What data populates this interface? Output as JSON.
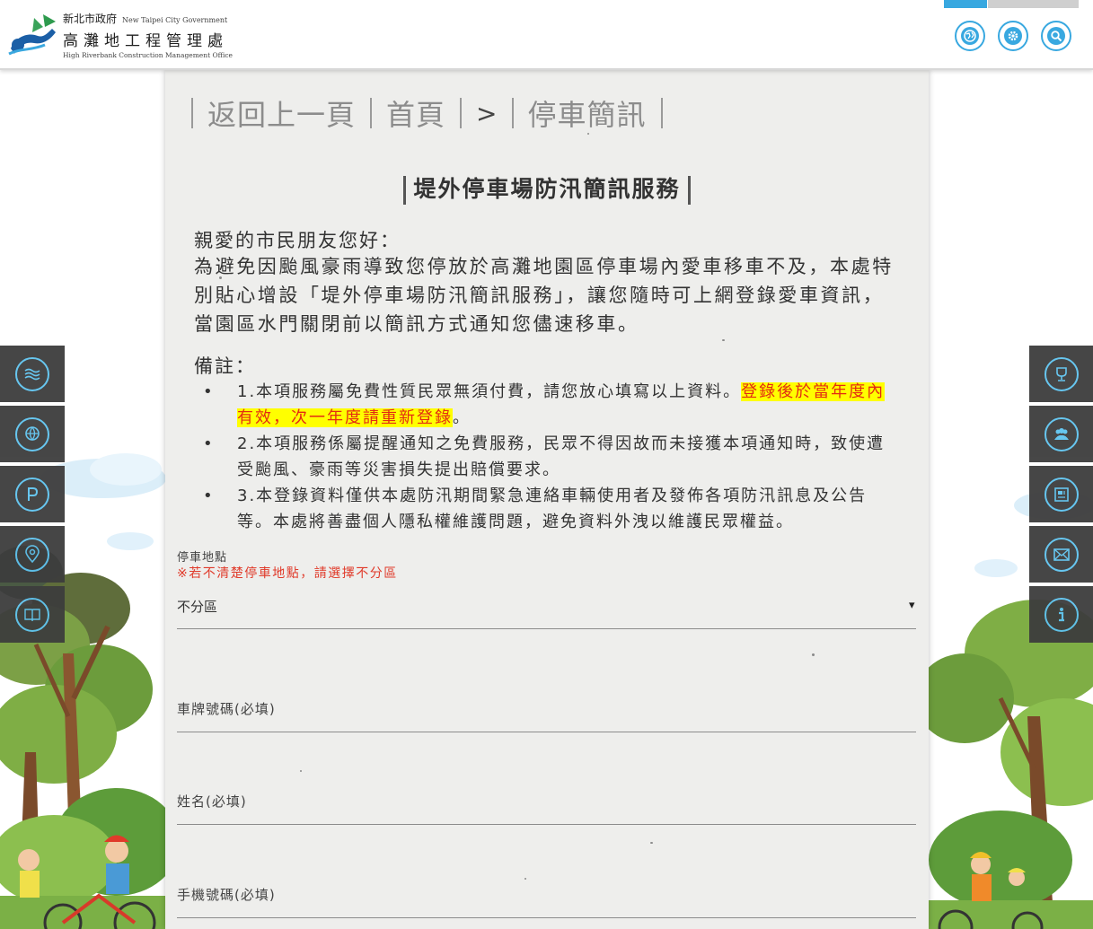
{
  "header": {
    "logo": {
      "zh_gov": "新北市政府",
      "en_gov": "New Taipei City Government",
      "zh_office": "高灘地工程管理處",
      "en_office": "High Riverbank Construction Management Office"
    },
    "icons": [
      "globe-icon",
      "gear-icon",
      "search-icon"
    ],
    "accent_color": "#38a8e0"
  },
  "breadcrumb": {
    "back": "返回上一頁",
    "home": "首頁",
    "arrow": ">",
    "current": "停車簡訊"
  },
  "page": {
    "title": "堤外停車場防汛簡訊服務",
    "greeting": "親愛的市民朋友您好：",
    "intro": "為避免因颱風豪雨導致您停放於高灘地園區停車場內愛車移車不及，本處特別貼心增設「堤外停車場防汛簡訊服務」，讓您隨時可上網登錄愛車資訊，當園區水門關閉前以簡訊方式通知您儘速移車。",
    "notes_title": "備註：",
    "notes": [
      {
        "text": "1.本項服務屬免費性質民眾無須付費，請您放心填寫以上資料。",
        "highlight": "登錄後於當年度內有效，次一年度請重新登錄",
        "after": "。"
      },
      {
        "text": "2.本項服務係屬提醒通知之免費服務，民眾不得因故而未接獲本項通知時，致使遭受颱風、豪雨等災害損失提出賠償要求。"
      },
      {
        "text": "3.本登錄資料僅供本處防汛期間緊急連絡車輛使用者及發佈各項防汛訊息及公告等。本處將善盡個人隱私權維護問題，避免資料外洩以維護民眾權益。"
      }
    ]
  },
  "form": {
    "parking": {
      "label": "停車地點",
      "hint": "※若不清楚停車地點，請選擇不分區",
      "selected": "不分區"
    },
    "plate": {
      "label": "車牌號碼(必填)"
    },
    "name": {
      "label": "姓名(必填)"
    },
    "phone": {
      "label": "手機號碼(必填)"
    }
  },
  "left_menu": [
    "waves-icon",
    "globe-people-icon",
    "parking-icon",
    "location-pin-icon",
    "book-icon"
  ],
  "right_menu": [
    "trophy-icon",
    "group-icon",
    "news-icon",
    "mail-icon",
    "info-icon"
  ]
}
